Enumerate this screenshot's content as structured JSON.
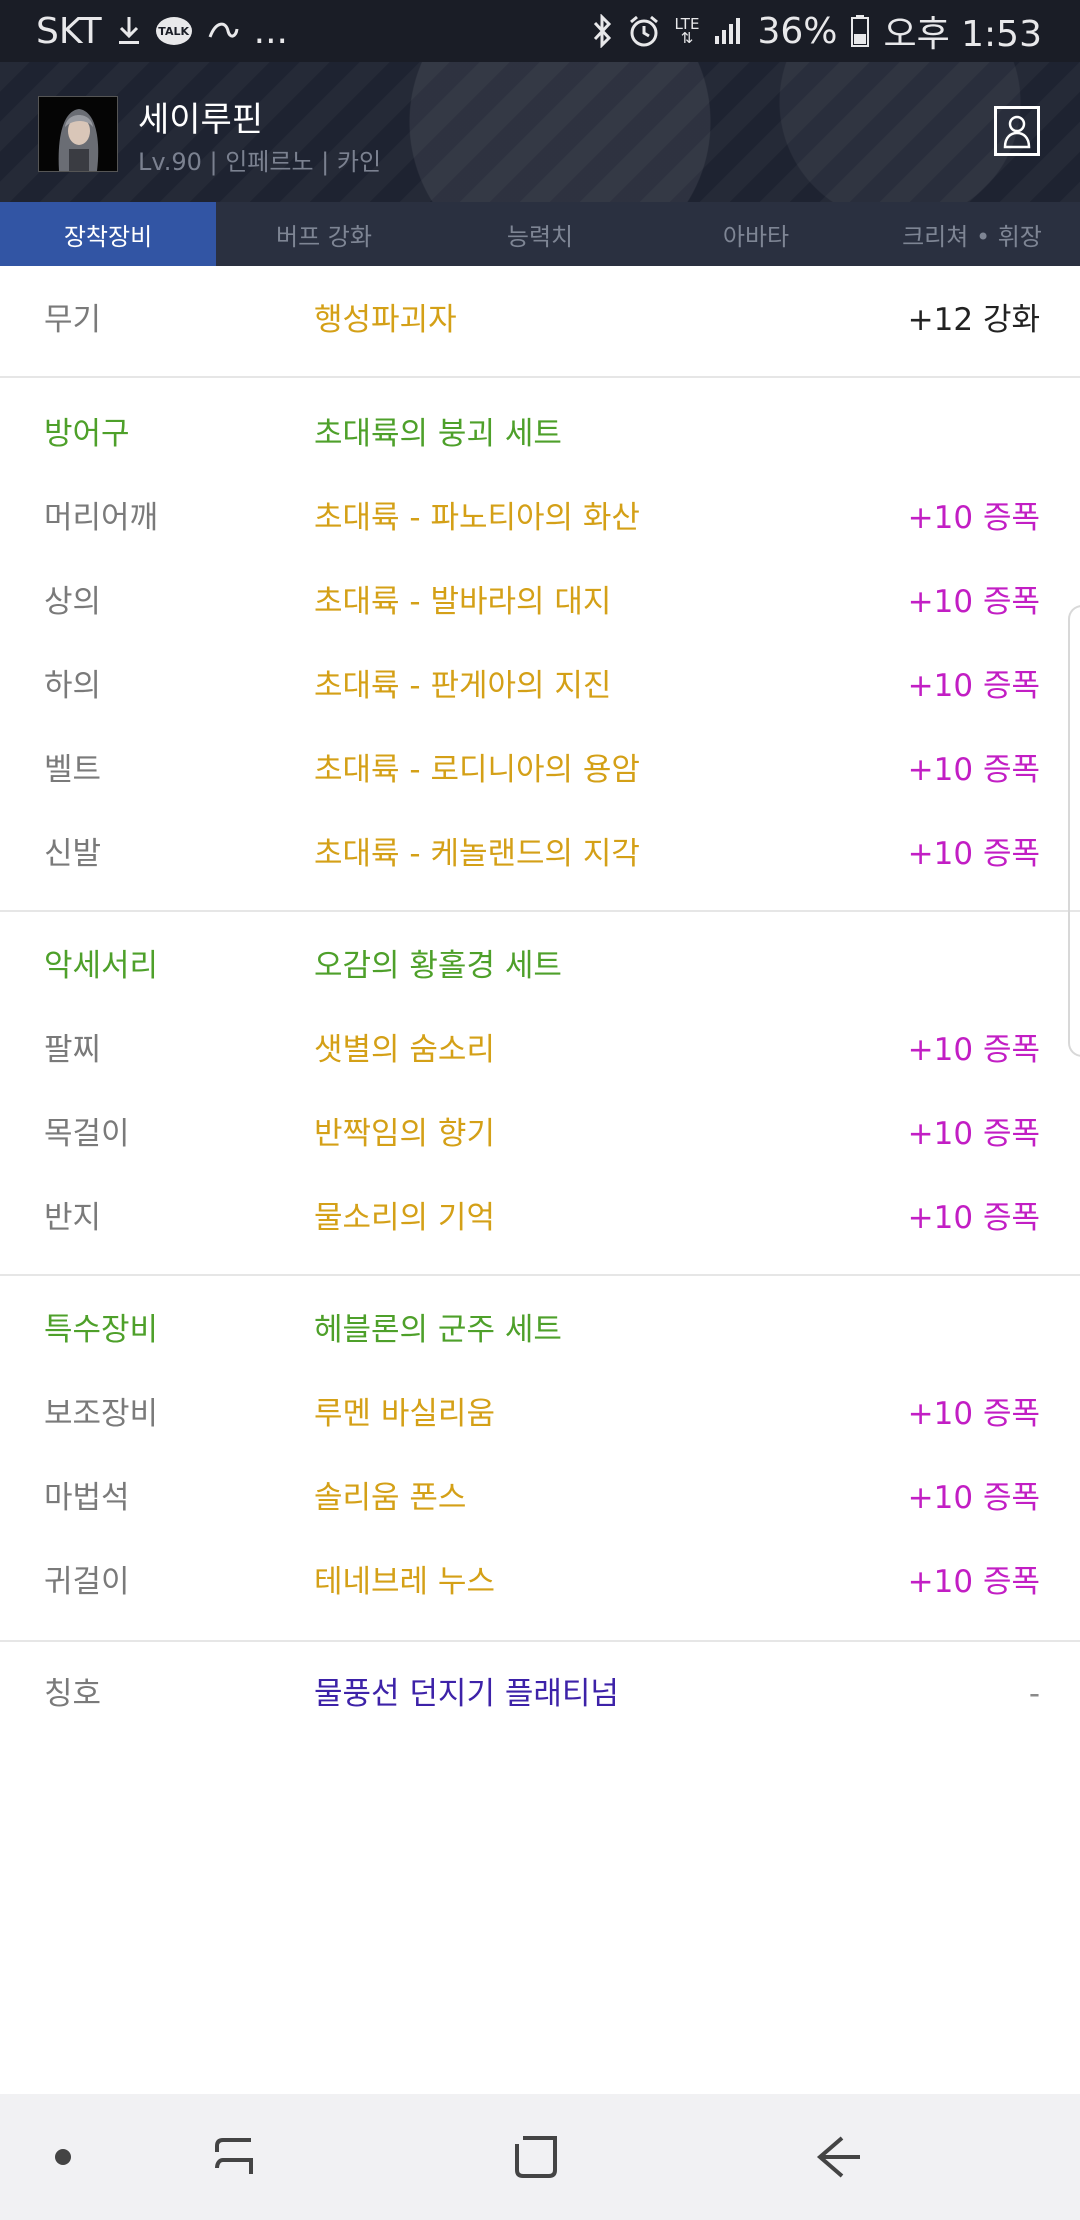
{
  "status_bar": {
    "carrier": "SKT",
    "dots": "...",
    "lte": "LTE",
    "battery": "36%",
    "time": "오후 1:53",
    "icons": [
      "download-icon",
      "kakaotalk-icon",
      "link-icon",
      "bluetooth-icon",
      "alarm-icon",
      "lte-icon",
      "signal-icon",
      "battery-icon"
    ]
  },
  "header": {
    "character_name": "세이루핀",
    "character_info": "Lv.90 | 인페르노 | 카인"
  },
  "tabs": [
    {
      "label": "장착장비",
      "active": true
    },
    {
      "label": "버프 강화",
      "active": false
    },
    {
      "label": "능력치",
      "active": false
    },
    {
      "label": "아바타",
      "active": false
    },
    {
      "label": "크리쳐 • 휘장",
      "active": false
    }
  ],
  "weapon": {
    "label": "무기",
    "name": "행성파괴자",
    "upgrade": "+12 강화"
  },
  "armor": {
    "category": "방어구",
    "set_name": "초대륙의 붕괴 세트",
    "items": [
      {
        "slot": "머리어깨",
        "name": "초대륙 - 파노티아의 화산",
        "upgrade": "+10 증폭"
      },
      {
        "slot": "상의",
        "name": "초대륙 - 발바라의 대지",
        "upgrade": "+10 증폭"
      },
      {
        "slot": "하의",
        "name": "초대륙 - 판게아의 지진",
        "upgrade": "+10 증폭"
      },
      {
        "slot": "벨트",
        "name": "초대륙 - 로디니아의 용암",
        "upgrade": "+10 증폭"
      },
      {
        "slot": "신발",
        "name": "초대륙 - 케놀랜드의 지각",
        "upgrade": "+10 증폭"
      }
    ]
  },
  "accessory": {
    "category": "악세서리",
    "set_name": "오감의 황홀경 세트",
    "items": [
      {
        "slot": "팔찌",
        "name": "샛별의 숨소리",
        "upgrade": "+10 증폭"
      },
      {
        "slot": "목걸이",
        "name": "반짝임의 향기",
        "upgrade": "+10 증폭"
      },
      {
        "slot": "반지",
        "name": "물소리의 기억",
        "upgrade": "+10 증폭"
      }
    ]
  },
  "special": {
    "category": "특수장비",
    "set_name": "헤블론의 군주 세트",
    "items": [
      {
        "slot": "보조장비",
        "name": "루멘 바실리움",
        "upgrade": "+10 증폭"
      },
      {
        "slot": "마법석",
        "name": "솔리움 폰스",
        "upgrade": "+10 증폭"
      },
      {
        "slot": "귀걸이",
        "name": "테네브레 누스",
        "upgrade": "+10 증폭"
      }
    ]
  },
  "title": {
    "label": "칭호",
    "name": "물풍선 던지기 플래티넘",
    "upgrade": "-"
  },
  "colors": {
    "item_gold": "#d4a017",
    "category_green": "#4ea02a",
    "amplify_magenta": "#c21ec4",
    "title_purple": "#3d22a8",
    "tab_active": "#3255a4"
  },
  "navbar": {
    "icons": [
      "dot-icon",
      "recent-apps-icon",
      "home-icon",
      "back-icon"
    ]
  }
}
